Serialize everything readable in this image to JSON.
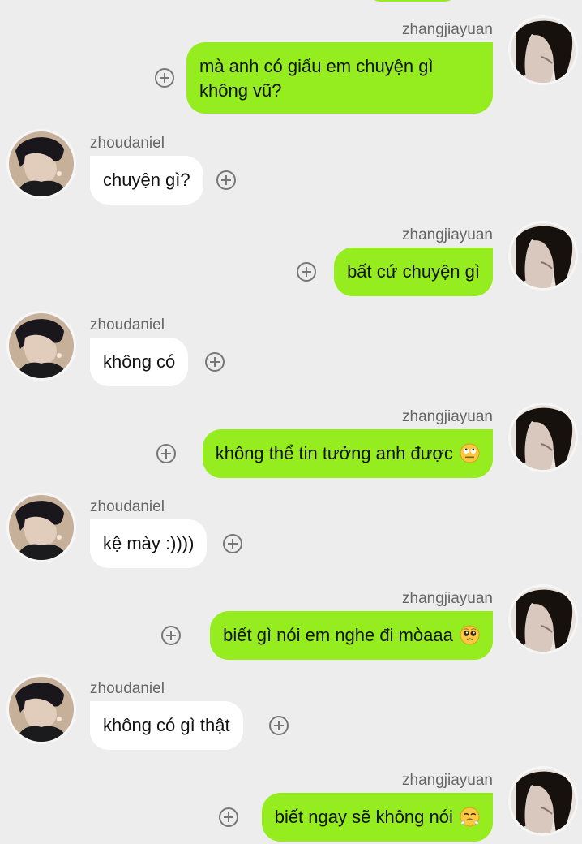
{
  "chat": {
    "messages": [
      {
        "side": "right",
        "username": "zhangjiayuan",
        "text": "mà anh có giấu em chuyện gì không vũ?",
        "emoji": null
      },
      {
        "side": "left",
        "username": "zhoudaniel",
        "text": "chuyện gì?",
        "emoji": null
      },
      {
        "side": "right",
        "username": "zhangjiayuan",
        "text": "bất cứ chuyện gì",
        "emoji": null
      },
      {
        "side": "left",
        "username": "zhoudaniel",
        "text": "không có",
        "emoji": null
      },
      {
        "side": "right",
        "username": "zhangjiayuan",
        "text": "không thể tin tưởng anh được",
        "emoji": "eye-roll-emoji"
      },
      {
        "side": "left",
        "username": "zhoudaniel",
        "text": "kệ mày :))))",
        "emoji": null
      },
      {
        "side": "right",
        "username": "zhangjiayuan",
        "text": "biết gì nói em nghe đi mòaaa",
        "emoji": "pleading-emoji"
      },
      {
        "side": "left",
        "username": "zhoudaniel",
        "text": "không có gì thật",
        "emoji": null
      },
      {
        "side": "right",
        "username": "zhangjiayuan",
        "text": "biết ngay sẽ không nói",
        "emoji": "huffing-emoji"
      }
    ]
  },
  "colors": {
    "background": "#ededed",
    "outgoing_bubble": "#95ec1f",
    "incoming_bubble": "#ffffff",
    "username": "#666666",
    "text": "#121212",
    "plus_icon": "#777777"
  },
  "icons": {
    "add": "plus-circle-icon",
    "avatar": "profile-photo"
  }
}
